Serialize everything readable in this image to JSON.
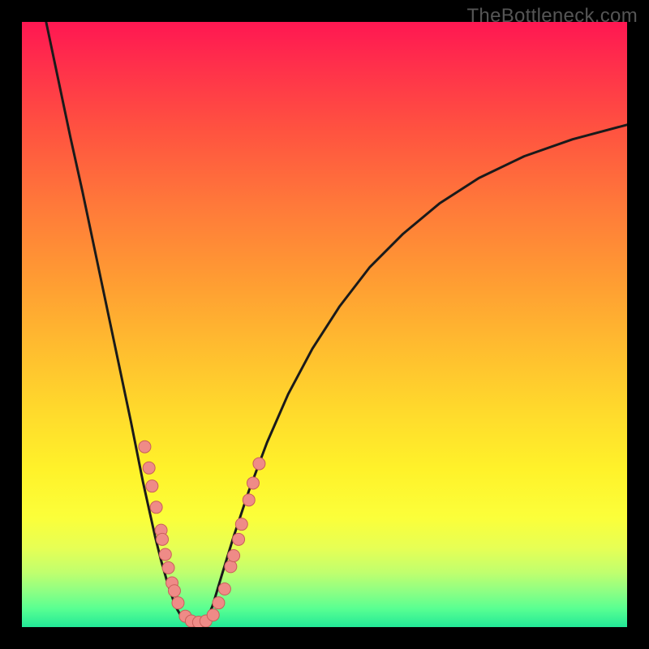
{
  "watermark": "TheBottleneck.com",
  "colors": {
    "background": "#000000",
    "curve_stroke": "#1a1a1a",
    "marker_fill": "#ef8b87",
    "marker_stroke": "#c95f5a"
  },
  "chart_data": {
    "type": "line",
    "title": "",
    "xlabel": "",
    "ylabel": "",
    "xlim": [
      0,
      1
    ],
    "ylim": [
      0,
      1
    ],
    "series": [
      {
        "name": "left-curve",
        "x": [
          0.04,
          0.06,
          0.08,
          0.1,
          0.12,
          0.14,
          0.16,
          0.18,
          0.2,
          0.21,
          0.22,
          0.23,
          0.24,
          0.25,
          0.255,
          0.262,
          0.27,
          0.278,
          0.287,
          0.3
        ],
        "y": [
          1.0,
          0.905,
          0.81,
          0.72,
          0.625,
          0.53,
          0.435,
          0.34,
          0.24,
          0.195,
          0.15,
          0.11,
          0.075,
          0.045,
          0.032,
          0.02,
          0.01,
          0.004,
          0.001,
          0.0
        ]
      },
      {
        "name": "right-curve",
        "x": [
          0.3,
          0.315,
          0.33,
          0.35,
          0.375,
          0.405,
          0.44,
          0.48,
          0.525,
          0.575,
          0.63,
          0.69,
          0.755,
          0.83,
          0.91,
          1.0
        ],
        "y": [
          0.0,
          0.035,
          0.085,
          0.15,
          0.225,
          0.305,
          0.385,
          0.46,
          0.53,
          0.595,
          0.65,
          0.7,
          0.742,
          0.778,
          0.806,
          0.83
        ]
      }
    ],
    "markers": [
      {
        "x": 0.203,
        "y": 0.298
      },
      {
        "x": 0.21,
        "y": 0.263
      },
      {
        "x": 0.215,
        "y": 0.233
      },
      {
        "x": 0.222,
        "y": 0.198
      },
      {
        "x": 0.23,
        "y": 0.16
      },
      {
        "x": 0.232,
        "y": 0.145
      },
      {
        "x": 0.237,
        "y": 0.12
      },
      {
        "x": 0.242,
        "y": 0.098
      },
      {
        "x": 0.248,
        "y": 0.073
      },
      {
        "x": 0.252,
        "y": 0.06
      },
      {
        "x": 0.258,
        "y": 0.04
      },
      {
        "x": 0.27,
        "y": 0.018
      },
      {
        "x": 0.28,
        "y": 0.01
      },
      {
        "x": 0.292,
        "y": 0.008
      },
      {
        "x": 0.304,
        "y": 0.01
      },
      {
        "x": 0.316,
        "y": 0.02
      },
      {
        "x": 0.325,
        "y": 0.04
      },
      {
        "x": 0.335,
        "y": 0.063
      },
      {
        "x": 0.345,
        "y": 0.1
      },
      {
        "x": 0.35,
        "y": 0.118
      },
      {
        "x": 0.358,
        "y": 0.145
      },
      {
        "x": 0.363,
        "y": 0.17
      },
      {
        "x": 0.375,
        "y": 0.21
      },
      {
        "x": 0.382,
        "y": 0.238
      },
      {
        "x": 0.392,
        "y": 0.27
      }
    ]
  }
}
